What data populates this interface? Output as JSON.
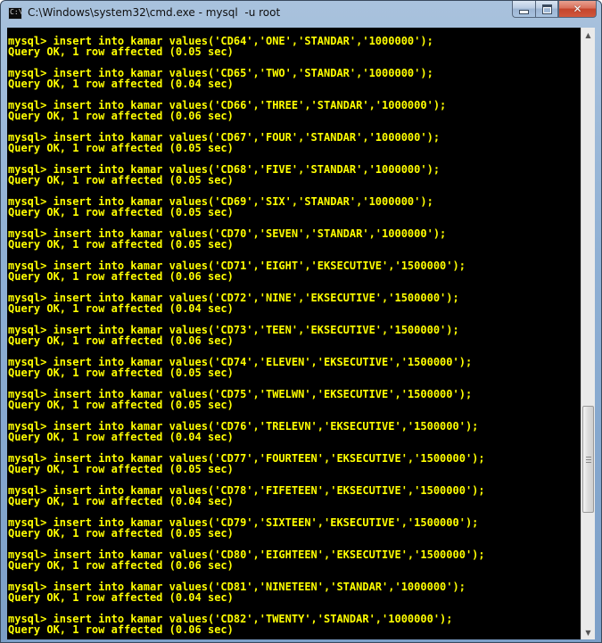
{
  "window": {
    "title": "C:\\Windows\\system32\\cmd.exe - mysql  -u root",
    "icon": "cmd-icon",
    "icon_text": "C:\\"
  },
  "caption_buttons": {
    "minimize": "minimize-icon",
    "maximize": "maximize-icon",
    "close": "close-icon",
    "close_glyph": "✕"
  },
  "console": {
    "text_color": "#ffff00",
    "background": "#000000",
    "entries": [
      {
        "command": "mysql> insert into kamar values('CD64','ONE','STANDAR','1000000');",
        "result": "Query OK, 1 row affected (0.05 sec)"
      },
      {
        "command": "mysql> insert into kamar values('CD65','TWO','STANDAR','1000000');",
        "result": "Query OK, 1 row affected (0.04 sec)"
      },
      {
        "command": "mysql> insert into kamar values('CD66','THREE','STANDAR','1000000');",
        "result": "Query OK, 1 row affected (0.06 sec)"
      },
      {
        "command": "mysql> insert into kamar values('CD67','FOUR','STANDAR','1000000');",
        "result": "Query OK, 1 row affected (0.05 sec)"
      },
      {
        "command": "mysql> insert into kamar values('CD68','FIVE','STANDAR','1000000');",
        "result": "Query OK, 1 row affected (0.05 sec)"
      },
      {
        "command": "mysql> insert into kamar values('CD69','SIX','STANDAR','1000000');",
        "result": "Query OK, 1 row affected (0.05 sec)"
      },
      {
        "command": "mysql> insert into kamar values('CD70','SEVEN','STANDAR','1000000');",
        "result": "Query OK, 1 row affected (0.05 sec)"
      },
      {
        "command": "mysql> insert into kamar values('CD71','EIGHT','EKSECUTIVE','1500000');",
        "result": "Query OK, 1 row affected (0.06 sec)"
      },
      {
        "command": "mysql> insert into kamar values('CD72','NINE','EKSECUTIVE','1500000');",
        "result": "Query OK, 1 row affected (0.04 sec)"
      },
      {
        "command": "mysql> insert into kamar values('CD73','TEEN','EKSECUTIVE','1500000');",
        "result": "Query OK, 1 row affected (0.06 sec)"
      },
      {
        "command": "mysql> insert into kamar values('CD74','ELEVEN','EKSECUTIVE','1500000');",
        "result": "Query OK, 1 row affected (0.05 sec)"
      },
      {
        "command": "mysql> insert into kamar values('CD75','TWELWN','EKSECUTIVE','1500000');",
        "result": "Query OK, 1 row affected (0.05 sec)"
      },
      {
        "command": "mysql> insert into kamar values('CD76','TRELEVN','EKSECUTIVE','1500000');",
        "result": "Query OK, 1 row affected (0.04 sec)"
      },
      {
        "command": "mysql> insert into kamar values('CD77','FOURTEEN','EKSECUTIVE','1500000');",
        "result": "Query OK, 1 row affected (0.05 sec)"
      },
      {
        "command": "mysql> insert into kamar values('CD78','FIFETEEN','EKSECUTIVE','1500000');",
        "result": "Query OK, 1 row affected (0.04 sec)"
      },
      {
        "command": "mysql> insert into kamar values('CD79','SIXTEEN','EKSECUTIVE','1500000');",
        "result": "Query OK, 1 row affected (0.05 sec)"
      },
      {
        "command": "mysql> insert into kamar values('CD80','EIGHTEEN','EKSECUTIVE','1500000');",
        "result": "Query OK, 1 row affected (0.06 sec)"
      },
      {
        "command": "mysql> insert into kamar values('CD81','NINETEEN','STANDAR','1000000');",
        "result": "Query OK, 1 row affected (0.04 sec)"
      },
      {
        "command": "mysql> insert into kamar values('CD82','TWENTY','STANDAR','1000000');",
        "result": "Query OK, 1 row affected (0.06 sec)"
      }
    ]
  },
  "scrollbar": {
    "up_icon": "scroll-up-arrow-icon",
    "down_icon": "scroll-down-arrow-icon",
    "up_glyph": "▲",
    "down_glyph": "▼"
  }
}
